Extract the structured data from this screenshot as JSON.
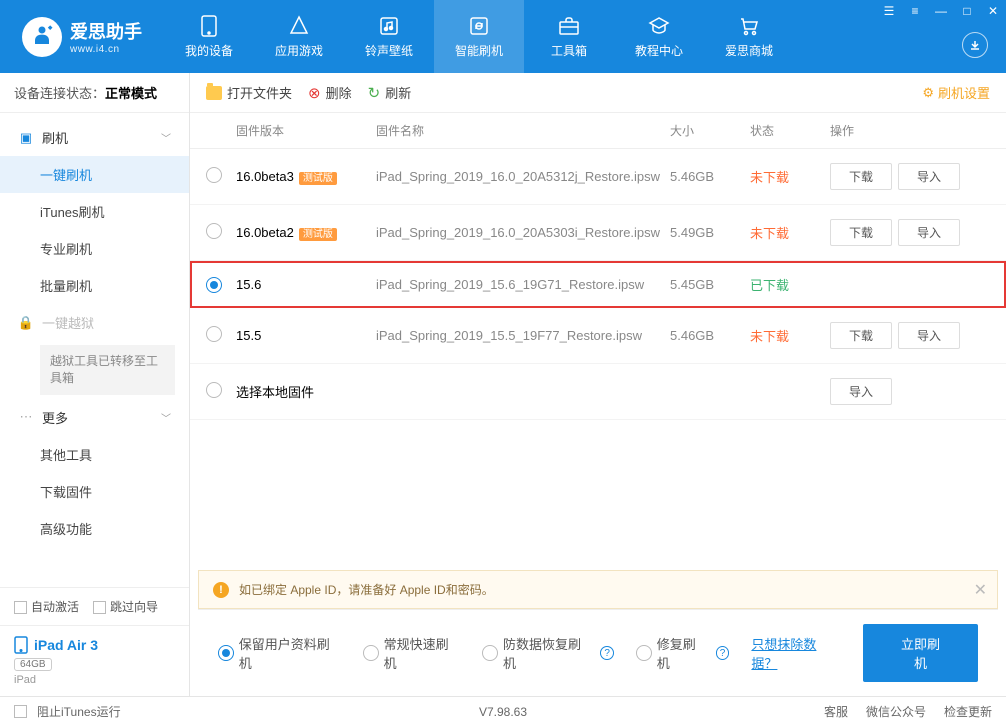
{
  "brand": {
    "title": "爱思助手",
    "subtitle": "www.i4.cn"
  },
  "nav": {
    "items": [
      {
        "label": "我的设备"
      },
      {
        "label": "应用游戏"
      },
      {
        "label": "铃声壁纸"
      },
      {
        "label": "智能刷机"
      },
      {
        "label": "工具箱"
      },
      {
        "label": "教程中心"
      },
      {
        "label": "爱思商城"
      }
    ]
  },
  "connection": {
    "label": "设备连接状态：",
    "value": "正常模式"
  },
  "sidebar": {
    "groups": {
      "flash": {
        "label": "刷机",
        "items": [
          "一键刷机",
          "iTunes刷机",
          "专业刷机",
          "批量刷机"
        ]
      },
      "jailbreak": {
        "label": "一键越狱",
        "note": "越狱工具已转移至工具箱"
      },
      "more": {
        "label": "更多",
        "items": [
          "其他工具",
          "下载固件",
          "高级功能"
        ]
      }
    },
    "options": {
      "auto_activate": "自动激活",
      "skip_guide": "跳过向导"
    }
  },
  "device": {
    "name": "iPad Air 3",
    "capacity": "64GB",
    "type": "iPad"
  },
  "toolbar": {
    "open_folder": "打开文件夹",
    "delete": "删除",
    "refresh": "刷新",
    "settings": "刷机设置"
  },
  "table": {
    "headers": {
      "version": "固件版本",
      "name": "固件名称",
      "size": "大小",
      "status": "状态",
      "ops": "操作"
    },
    "download_btn": "下载",
    "import_btn": "导入",
    "beta_badge": "测试版",
    "local_select": "选择本地固件",
    "rows": [
      {
        "version": "16.0beta3",
        "beta": true,
        "name": "iPad_Spring_2019_16.0_20A5312j_Restore.ipsw",
        "size": "5.46GB",
        "status": "未下载",
        "download": true
      },
      {
        "version": "16.0beta2",
        "beta": true,
        "name": "iPad_Spring_2019_16.0_20A5303i_Restore.ipsw",
        "size": "5.49GB",
        "status": "未下载",
        "download": true
      },
      {
        "version": "15.6",
        "beta": false,
        "name": "iPad_Spring_2019_15.6_19G71_Restore.ipsw",
        "size": "5.45GB",
        "status": "已下载",
        "download": false,
        "selected": true
      },
      {
        "version": "15.5",
        "beta": false,
        "name": "iPad_Spring_2019_15.5_19F77_Restore.ipsw",
        "size": "5.46GB",
        "status": "未下载",
        "download": true
      }
    ]
  },
  "notice": "如已绑定 Apple ID，请准备好 Apple ID和密码。",
  "flash_options": {
    "opt1": "保留用户资料刷机",
    "opt2": "常规快速刷机",
    "opt3": "防数据恢复刷机",
    "opt4": "修复刷机",
    "link": "只想抹除数据？",
    "button": "立即刷机"
  },
  "bottom": {
    "block_itunes": "阻止iTunes运行",
    "version": "V7.98.63",
    "service": "客服",
    "wechat": "微信公众号",
    "update": "检查更新"
  }
}
